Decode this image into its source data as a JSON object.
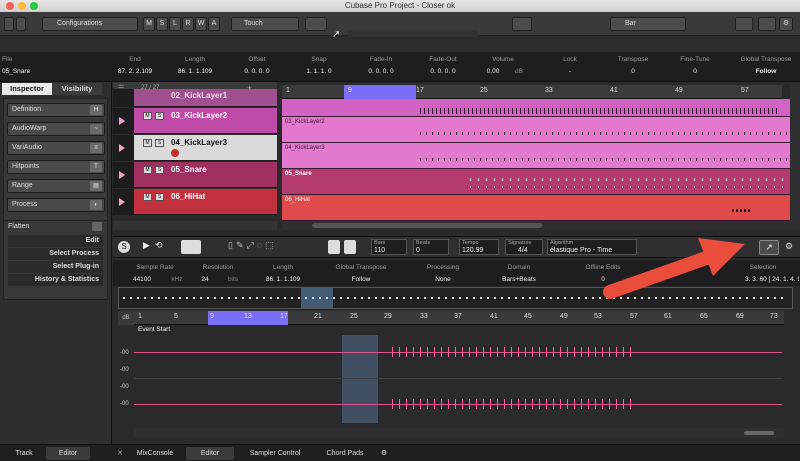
{
  "window": {
    "title": "Cubase Pro Project - Closer ok"
  },
  "toolbar": {
    "configurations": "Configurations",
    "touch": "Touch",
    "bar": "Bar",
    "mode_buttons": [
      "M",
      "S",
      "L",
      "R",
      "W",
      "A"
    ]
  },
  "info_line": {
    "headers": [
      "File",
      "End",
      "Length",
      "Offset",
      "Snap",
      "Fade-In",
      "Fade-Out",
      "Volume",
      "Lock",
      "Transpose",
      "Fine-Tune",
      "Global Transpose"
    ],
    "values": [
      "05_Snare",
      "87. 2. 2.109",
      "86. 1. 1.109",
      "0. 0. 0. 0",
      "1. 1. 1. 0",
      "0. 0. 0. 0",
      "0. 0. 0. 0",
      "0.00",
      "-",
      "0",
      "0",
      "Follow"
    ],
    "volume_unit": "dB"
  },
  "inspector": {
    "tabs": [
      "Inspector",
      "Visibility"
    ],
    "track_count": "27 / 27",
    "sections": [
      "Definition",
      "AudioWarp",
      "VariAudio",
      "Hitpoints",
      "Range",
      "Process"
    ],
    "flatten": "Flatten",
    "menus": [
      "Edit",
      "Select Process",
      "Select Plug-in",
      "History & Statistics"
    ]
  },
  "tracks": [
    {
      "name": "02_KickLayer1",
      "color": "#a0508e"
    },
    {
      "name": "03_KickLayer2",
      "color": "#c04aa8"
    },
    {
      "name": "04_KickLayer3",
      "color": "#dadada"
    },
    {
      "name": "05_Snare",
      "color": "#a03060"
    },
    {
      "name": "06_HiHat",
      "color": "#c0303d"
    }
  ],
  "lanes": [
    {
      "label": "",
      "color": "#e070d0"
    },
    {
      "label": "03_KickLayer2",
      "color": "#e478cf"
    },
    {
      "label": "04_KickLayer3",
      "color": "#e27bd0"
    },
    {
      "label": "05_Snare",
      "color": "#b43a70"
    },
    {
      "label": "06_HiHat",
      "color": "#e04a4a"
    }
  ],
  "ruler_top": [
    "1",
    "9",
    "17",
    "25",
    "33",
    "41",
    "49",
    "57"
  ],
  "editor": {
    "bars": "Bars",
    "bars_value": "110",
    "beats": "Beats",
    "beats_value": "0",
    "tempo": "Tempo",
    "tempo_value": "120.99",
    "signature": "Signature",
    "signature_value": "4/4",
    "algorithm": "Algorithm",
    "algorithm_value": "élastique Pro - Time",
    "info_headers": [
      "Sample Rate",
      "Resolution",
      "Length",
      "Global Transpose",
      "Processing",
      "Domain",
      "Offline Edits",
      "Selection"
    ],
    "info_values": [
      "44100",
      "24",
      "86. 1. 1.109",
      "Follow",
      "None",
      "Bars+Beats",
      "0",
      "3. 3. 60 [ 24. 1. 4. 94 - 26."
    ],
    "units": [
      "kHz",
      "bits"
    ],
    "event_start": "Event Start",
    "db_label": "dB",
    "db_ticks": [
      "-00",
      "-00",
      "-00",
      "-00"
    ],
    "s_label": "S",
    "ruler": [
      "1",
      "5",
      "9",
      "13",
      "17",
      "21",
      "25",
      "29",
      "33",
      "37",
      "41",
      "45",
      "49",
      "53",
      "57",
      "61",
      "65",
      "69",
      "73"
    ],
    "waveform_ruler": [
      "1",
      "5",
      "9",
      "13",
      "17",
      "21",
      "25",
      "29",
      "33",
      "37",
      "41",
      "45",
      "49",
      "53",
      "57",
      "61",
      "65",
      "69",
      "73"
    ]
  },
  "bottom_tabs": [
    "Track",
    "Editor",
    "MixConsole",
    "Editor",
    "Sampler Control",
    "Chord Pads"
  ]
}
